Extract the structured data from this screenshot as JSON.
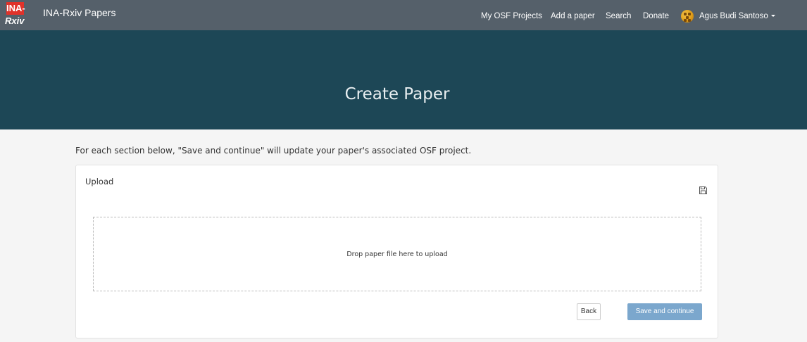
{
  "navbar": {
    "logo_top": "INA-",
    "logo_bottom": "Rxiv",
    "brand": "INA-Rxiv Papers",
    "links": {
      "my_osf_projects": "My OSF Projects",
      "add_paper": "Add a paper",
      "search": "Search",
      "donate": "Donate"
    },
    "user_name": "Agus Budi Santoso",
    "user_menu_icon": "caret-down-icon"
  },
  "hero": {
    "title": "Create Paper"
  },
  "main": {
    "intro": "For each section below, \"Save and continue\" will update your paper's associated OSF project.",
    "upload_panel": {
      "title": "Upload",
      "save_icon": "floppy-disk-icon",
      "dropzone_text": "Drop paper file here to upload",
      "back_label": "Back",
      "save_label": "Save and continue"
    }
  },
  "colors": {
    "navbar": "#55606a",
    "hero": "#1d4756",
    "page_bg": "#f5f5f5",
    "logo_red": "#e0322a",
    "primary_button": "#7ba7cd"
  }
}
